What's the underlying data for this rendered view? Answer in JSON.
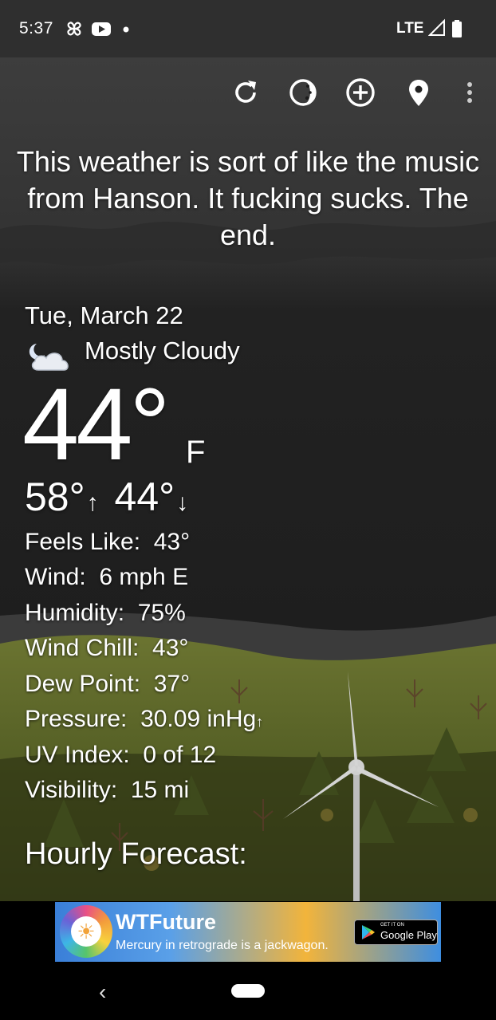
{
  "status_bar": {
    "time": "5:37",
    "network": "LTE",
    "icons": [
      "pinwheel-icon",
      "youtube-icon",
      "notification-dot-icon",
      "signal-icon",
      "battery-icon"
    ]
  },
  "toolbar": {
    "icons": [
      "refresh-icon",
      "theme-icon",
      "add-location-icon",
      "location-pin-icon",
      "more-options-icon"
    ]
  },
  "headline": "This weather is sort of like the music from Hanson. It fucking sucks. The end.",
  "current": {
    "date": "Tue, March 22",
    "condition": "Mostly Cloudy",
    "condition_icon": "night-cloudy-icon",
    "temperature": "44°",
    "unit": "F",
    "high": "58°",
    "low": "44°"
  },
  "details": [
    {
      "label": "Feels Like:",
      "value": "43°"
    },
    {
      "label": "Wind:",
      "value": "6 mph E"
    },
    {
      "label": "Humidity:",
      "value": "75%"
    },
    {
      "label": "Wind Chill:",
      "value": "43°"
    },
    {
      "label": "Dew Point:",
      "value": "37°"
    },
    {
      "label": "Pressure:",
      "value": "30.09 inHg"
    },
    {
      "label": "UV Index:",
      "value": "0 of 12"
    },
    {
      "label": "Visibility:",
      "value": "15 mi"
    }
  ],
  "hourly_heading": "Hourly Forecast:",
  "ad": {
    "title": "WTFuture",
    "subtitle": "Mercury in retrograde is a jackwagon.",
    "store_small": "GET IT ON",
    "store_big": "Google Play"
  },
  "colors": {
    "sky_dark": "#1c1c1c",
    "cloud_gray": "#3a3a3a",
    "hill_green": "#5f6a2a",
    "status_bar": "#2f2f2f"
  }
}
